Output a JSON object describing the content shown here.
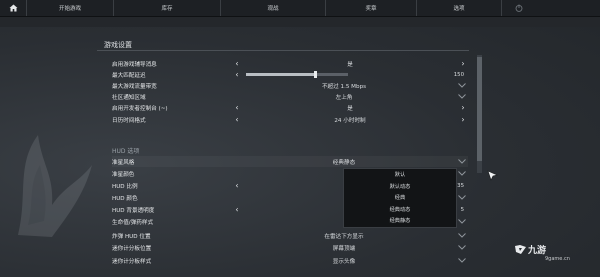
{
  "nav": {
    "home_icon": "home-icon",
    "items": [
      "开始游戏",
      "库存",
      "观战",
      "奖章",
      "选项"
    ],
    "power_icon": "power-icon"
  },
  "section_title": "游戏设置",
  "rows_top": [
    {
      "label": "启用游戏辅导消息",
      "type": "arrows",
      "value": "是"
    },
    {
      "label": "最大匹配延迟",
      "type": "slider",
      "value": "150",
      "fraction": 0.68
    },
    {
      "label": "最大游戏流量带宽",
      "type": "dropdown",
      "value": "不超过 1.5 Mbps"
    },
    {
      "label": "社区通知区域",
      "type": "dropdown",
      "value": "左上角"
    },
    {
      "label": "启用开发者控制台 (~)",
      "type": "arrows",
      "value": "是"
    },
    {
      "label": "日历时间格式",
      "type": "arrows",
      "value": "24 小时时制"
    }
  ],
  "hud_title": "HUD 选项",
  "rows_hud": [
    {
      "label": "准星风格",
      "type": "dropdown",
      "value": "经典静态"
    },
    {
      "label": "准星颜色",
      "type": "dropdown",
      "value": ""
    },
    {
      "label": "HUD 比例",
      "type": "arrows-partial",
      "value": "",
      "tail": "35"
    },
    {
      "label": "HUD 颜色",
      "type": "dropdown",
      "value": ""
    },
    {
      "label": "HUD 背景透明度",
      "type": "arrows-partial",
      "value": "",
      "tail": "5"
    },
    {
      "label": "生命值/弹药样式",
      "type": "dropdown",
      "value": ""
    },
    {
      "label": "炸弹 HUD 位置",
      "type": "dropdown",
      "value": "在雷达下方显示"
    },
    {
      "label": "迷你计分板位置",
      "type": "dropdown",
      "value": "屏幕顶端"
    },
    {
      "label": "迷你计分板样式",
      "type": "dropdown",
      "value": "显示头像"
    }
  ],
  "dropdown_options": [
    "默认",
    "默认动态",
    "经典",
    "经典动态",
    "经典静态"
  ],
  "watermark": {
    "brand": "九游",
    "sub": "9game.cn"
  },
  "colors": {
    "accent": "#e0e3e6",
    "panel": "#121416"
  }
}
